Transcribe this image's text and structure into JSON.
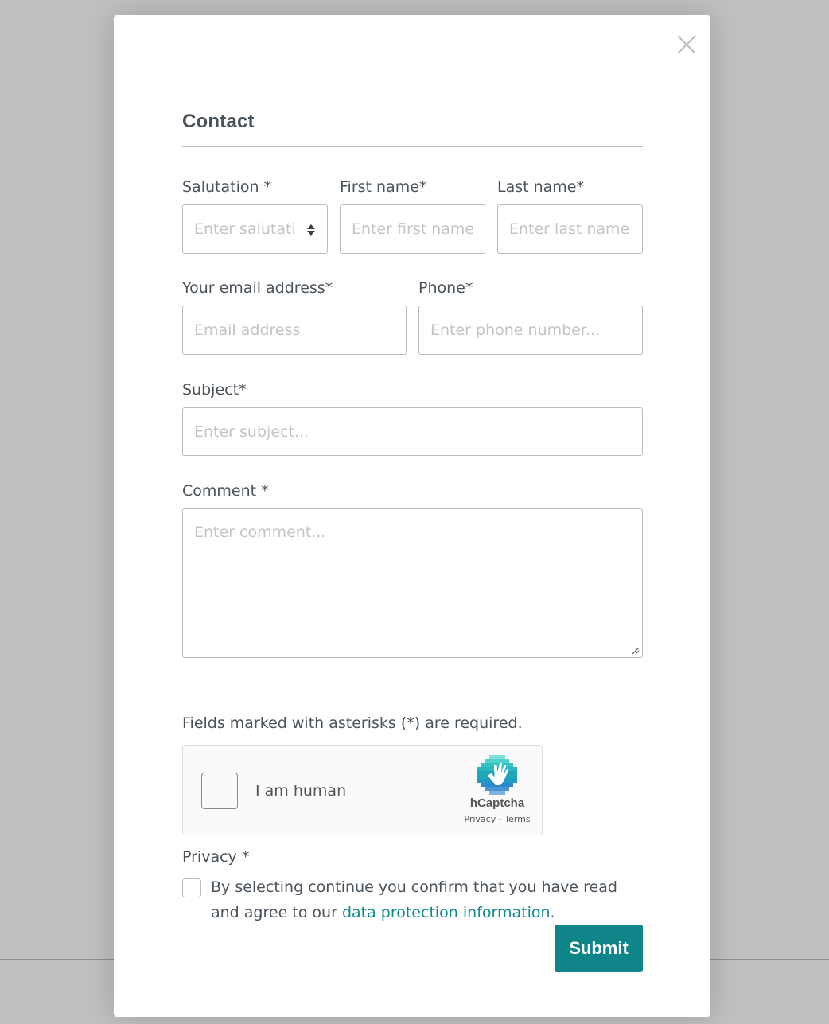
{
  "modal": {
    "title": "Contact",
    "close_icon": "close-icon"
  },
  "form": {
    "salutation": {
      "label": "Salutation *",
      "placeholder": "Enter salutati",
      "icon": "sort-arrows-icon"
    },
    "first_name": {
      "label": "First name*",
      "placeholder": "Enter first name"
    },
    "last_name": {
      "label": "Last name*",
      "placeholder": "Enter last name"
    },
    "email": {
      "label": "Your email address*",
      "placeholder": "Email address"
    },
    "phone": {
      "label": "Phone*",
      "placeholder": "Enter phone number..."
    },
    "subject": {
      "label": "Subject*",
      "placeholder": "Enter subject..."
    },
    "comment": {
      "label": "Comment *",
      "placeholder": "Enter comment..."
    },
    "required_note": "Fields marked with asterisks (*) are required.",
    "captcha": {
      "checkbox_label": "I am human",
      "brand": "hCaptcha",
      "privacy_link": "Privacy",
      "separator": " - ",
      "terms_link": "Terms",
      "checked": false
    },
    "privacy": {
      "label": "Privacy *",
      "text_before": "By selecting continue you confirm that you have read and agree to our ",
      "link_text": "data protection information",
      "text_after": ".",
      "checked": false
    },
    "submit_label": "Submit"
  },
  "colors": {
    "accent": "#0f858a",
    "link": "#0f8a8d",
    "text": "#4a535c",
    "placeholder": "#c4c4c4",
    "backdrop": "#c0c0c0"
  }
}
